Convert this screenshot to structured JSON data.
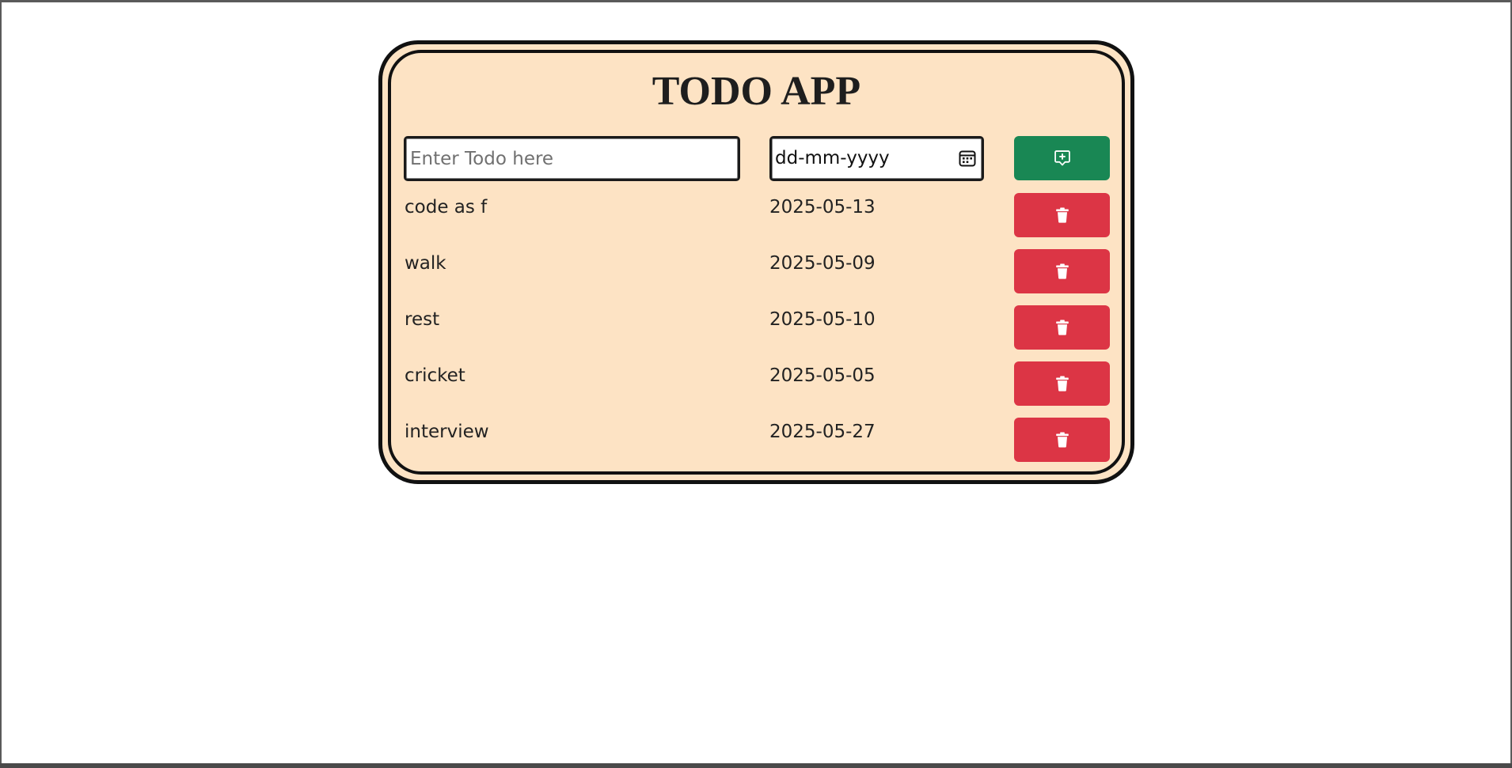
{
  "app": {
    "title": "TODO APP"
  },
  "form": {
    "todo_placeholder": "Enter Todo here",
    "date_placeholder": "dd-mm-yyyy",
    "add_icon": "chat-square-plus-icon"
  },
  "todos": [
    {
      "name": "code as f",
      "date": "2025-05-13"
    },
    {
      "name": "walk",
      "date": "2025-05-09"
    },
    {
      "name": "rest",
      "date": "2025-05-10"
    },
    {
      "name": "cricket",
      "date": "2025-05-05"
    },
    {
      "name": "interview",
      "date": "2025-05-27"
    }
  ],
  "colors": {
    "card_background": "#fde3c4",
    "add_button": "#198754",
    "delete_button": "#dc3545",
    "border": "#111111"
  },
  "icons": {
    "delete": "trash-icon",
    "calendar": "calendar-icon"
  }
}
